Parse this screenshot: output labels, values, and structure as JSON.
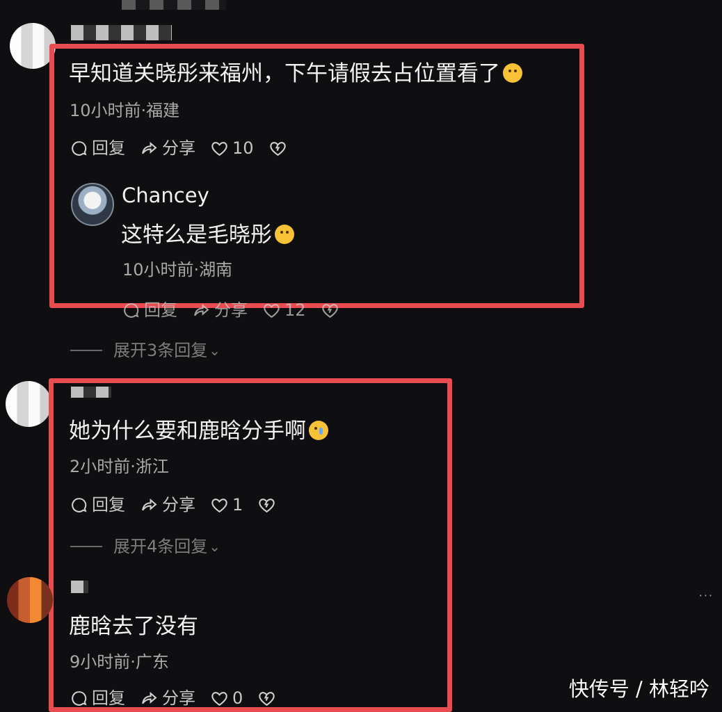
{
  "comments": [
    {
      "text": "早知道关晓彤来福州，下午请假去占位置看了",
      "meta": "10小时前·福建",
      "reply_label": "回复",
      "share_label": "分享",
      "like_count": "10"
    },
    {
      "author": "Chancey",
      "text": "这特么是毛晓彤",
      "meta": "10小时前·湖南",
      "reply_label": "回复",
      "share_label": "分享",
      "like_count": "12"
    },
    {
      "expand_label": "展开3条回复"
    },
    {
      "text": "她为什么要和鹿晗分手啊",
      "meta": "2小时前·浙江",
      "reply_label": "回复",
      "share_label": "分享",
      "like_count": "1",
      "expand_label": "展开4条回复"
    },
    {
      "text": "鹿晗去了没有",
      "meta": "9小时前·广东",
      "reply_label": "回复",
      "share_label": "分享",
      "like_count": "0"
    }
  ],
  "watermark": "快传号 / 林轻吟",
  "icons": [
    "reply-icon",
    "share-icon",
    "heart-icon",
    "broken-heart-icon",
    "chevron-down-icon",
    "emoji-icon"
  ],
  "colors": {
    "background": "#0f0f11",
    "highlight_border": "#e84b50",
    "primary_text": "#f3f3f3",
    "secondary_text": "#a9a9a9"
  }
}
